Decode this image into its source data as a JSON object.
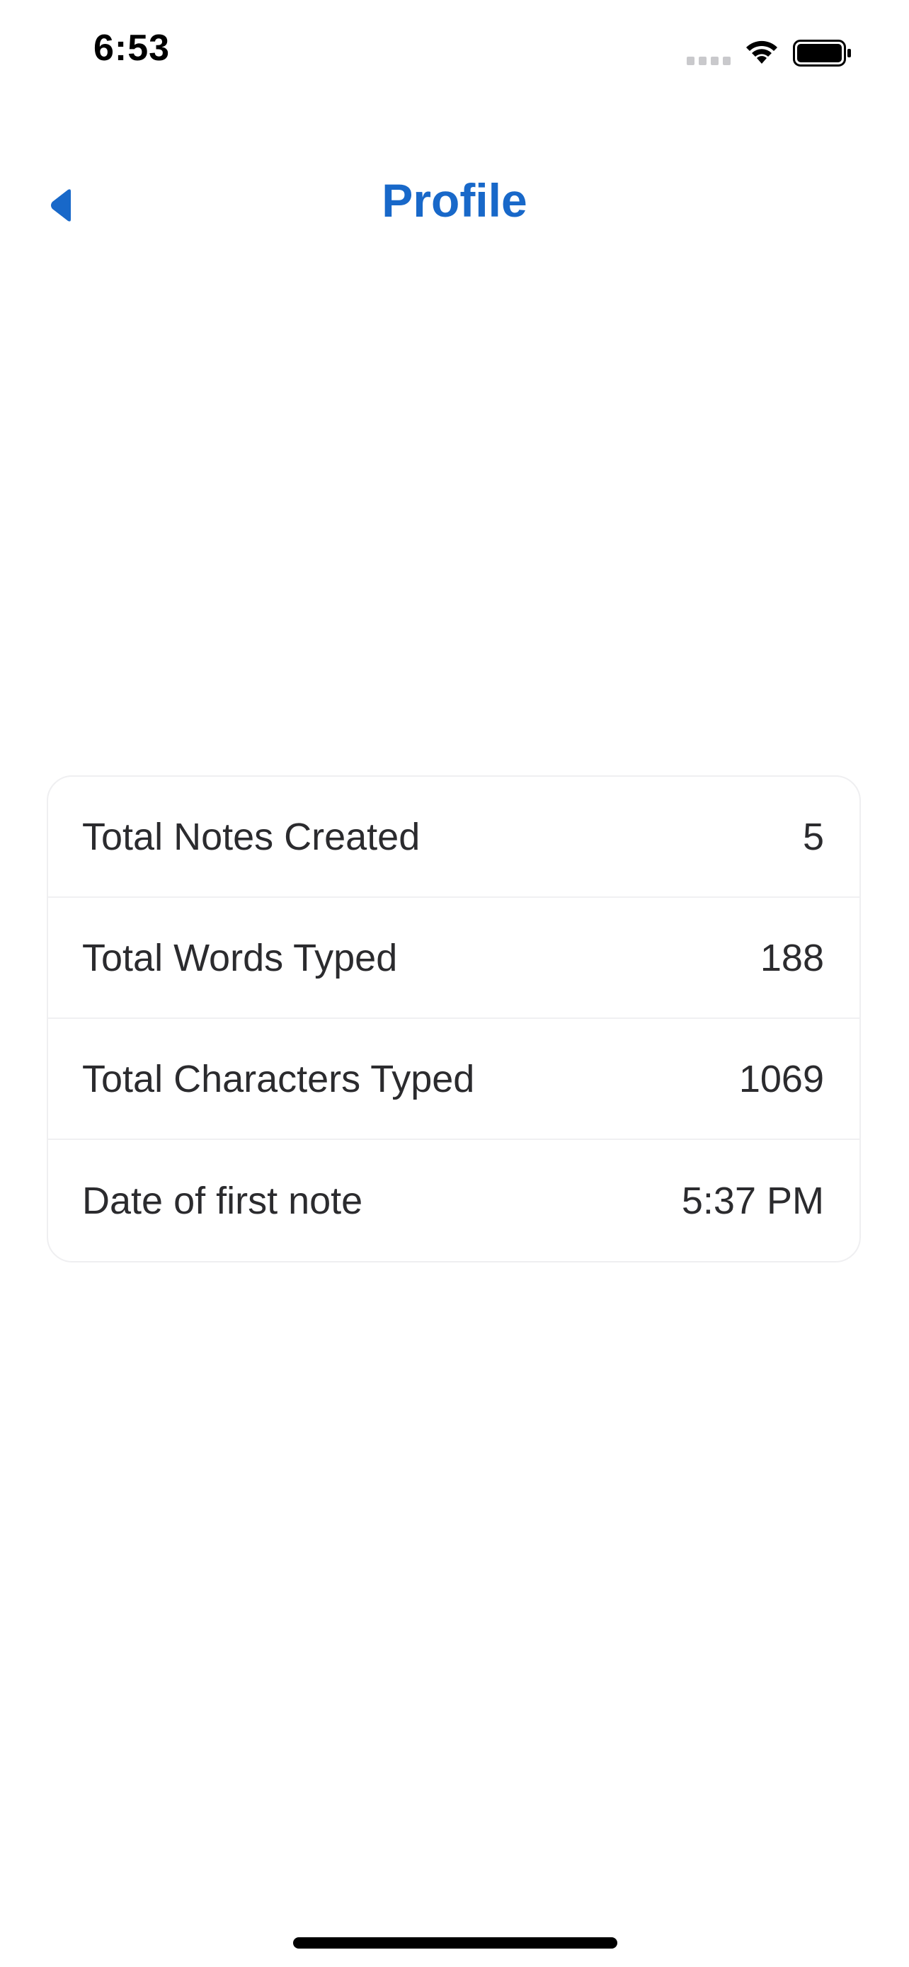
{
  "status_bar": {
    "time": "6:53"
  },
  "nav": {
    "title": "Profile",
    "back_icon": "back-triangle-icon",
    "accent_color": "#1868c9"
  },
  "stats": [
    {
      "label": "Total Notes Created",
      "value": "5"
    },
    {
      "label": "Total Words Typed",
      "value": "188"
    },
    {
      "label": "Total Characters Typed",
      "value": "1069"
    },
    {
      "label": "Date of first note",
      "value": "5:37 PM"
    }
  ]
}
